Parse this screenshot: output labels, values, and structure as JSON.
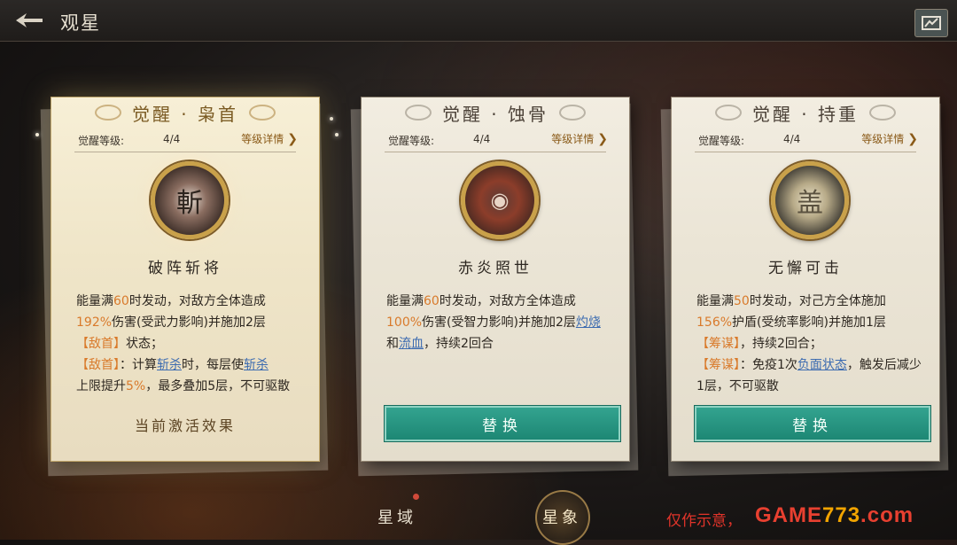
{
  "header": {
    "back_icon": "back-arrow-icon",
    "title": "观星",
    "right_icon": "star-map-icon"
  },
  "cards": [
    {
      "title": "觉醒 · 枭首",
      "level_label": "觉醒等级:",
      "level_value": "4/4",
      "detail_label": "等级详情",
      "emblem_glyph": "斬",
      "skill_name": "破阵斩将",
      "desc": {
        "p1": "能量满",
        "n1": "60",
        "p2": "时发动，对敌方全体造成",
        "n2": "192%",
        "p3": "伤害(受武力影响)并施加",
        "n3": "2层",
        "t1": "【敌首】",
        "p4": "状态；",
        "t2": "【敌首】",
        "p5": "：计算",
        "l1": "斩杀",
        "p6": "时，每层使",
        "l2": "斩杀",
        "p7": "上限提升",
        "n4": "5%",
        "p8": "，最多叠加5层，不可驱散"
      },
      "status": "当前激活效果"
    },
    {
      "title": "觉醒 · 蚀骨",
      "level_label": "觉醒等级:",
      "level_value": "4/4",
      "detail_label": "等级详情",
      "emblem_glyph": "◉",
      "skill_name": "赤炎照世",
      "desc": {
        "p1": "能量满",
        "n1": "60",
        "p2": "时发动，对敌方全体造成",
        "n2": "100%",
        "p3": "伤害(受智力影响)并施加",
        "n3": "2层",
        "l1": "灼烧",
        "p4": "和",
        "l2": "流血",
        "p5": "，持续2回合"
      },
      "button": "替换"
    },
    {
      "title": "觉醒 · 持重",
      "level_label": "觉醒等级:",
      "level_value": "4/4",
      "detail_label": "等级详情",
      "emblem_glyph": "盖",
      "skill_name": "无懈可击",
      "desc": {
        "p1": "能量满",
        "n1": "50",
        "p2": "时发动，对己方全体施加",
        "n2": "156%",
        "p3": "护盾(受统率影响)并施加1层",
        "t1": "【筹谋】",
        "p4": "，持续2回合；",
        "t2": "【筹谋】",
        "p5": "：免疫1次",
        "l1": "负面状态",
        "p6": "，触发后减少1层，不可驱散"
      },
      "button": "替换"
    }
  ],
  "tabs": [
    {
      "label": "星域"
    },
    {
      "label": "星象"
    }
  ],
  "watermark": {
    "note": "仅作示意，",
    "brand_a": "GAME",
    "brand_b": "773",
    "brand_c": ".com"
  },
  "colors": {
    "accent_teal": "#1d8774",
    "highlight_orange": "#d97a2b",
    "link_blue": "#3c6bb0",
    "active_gold": "#c9a14a"
  }
}
